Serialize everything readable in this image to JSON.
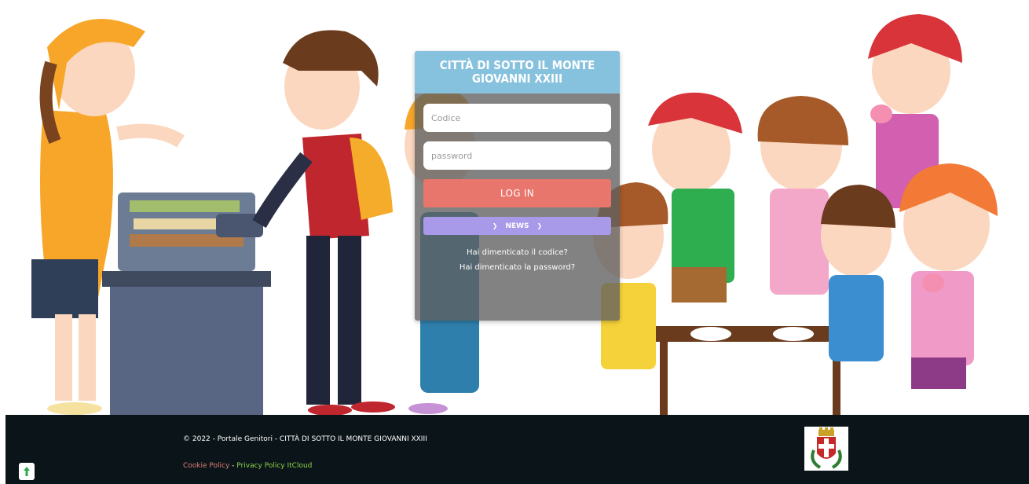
{
  "login": {
    "title": "CITTÀ DI SOTTO IL MONTE GIOVANNI XXIII",
    "code_placeholder": "Codice",
    "password_placeholder": "password",
    "login_button": "LOG IN",
    "news_button": "NEWS",
    "forgot_code": "Hai dimenticato il codice?",
    "forgot_password": "Hai dimenticato la password?"
  },
  "footer": {
    "copyright": "© 2022 - Portale Genitori - CITTÀ DI SOTTO IL MONTE GIOVANNI XXIII",
    "cookie_policy": "Cookie Policy",
    "separator": " - ",
    "privacy_policy": "Privacy Policy ItCloud"
  },
  "icons": {
    "news_chevron": "chevron-down-icon",
    "scroll_top": "arrow-up-icon",
    "crest": "municipality-crest"
  },
  "colors": {
    "header": "#86c1dd",
    "login_button": "#e8766c",
    "news_button": "#a89ae8",
    "footer_bg": "#0b1519",
    "cookie_link": "#e07b73",
    "privacy_link": "#8cd14a"
  }
}
